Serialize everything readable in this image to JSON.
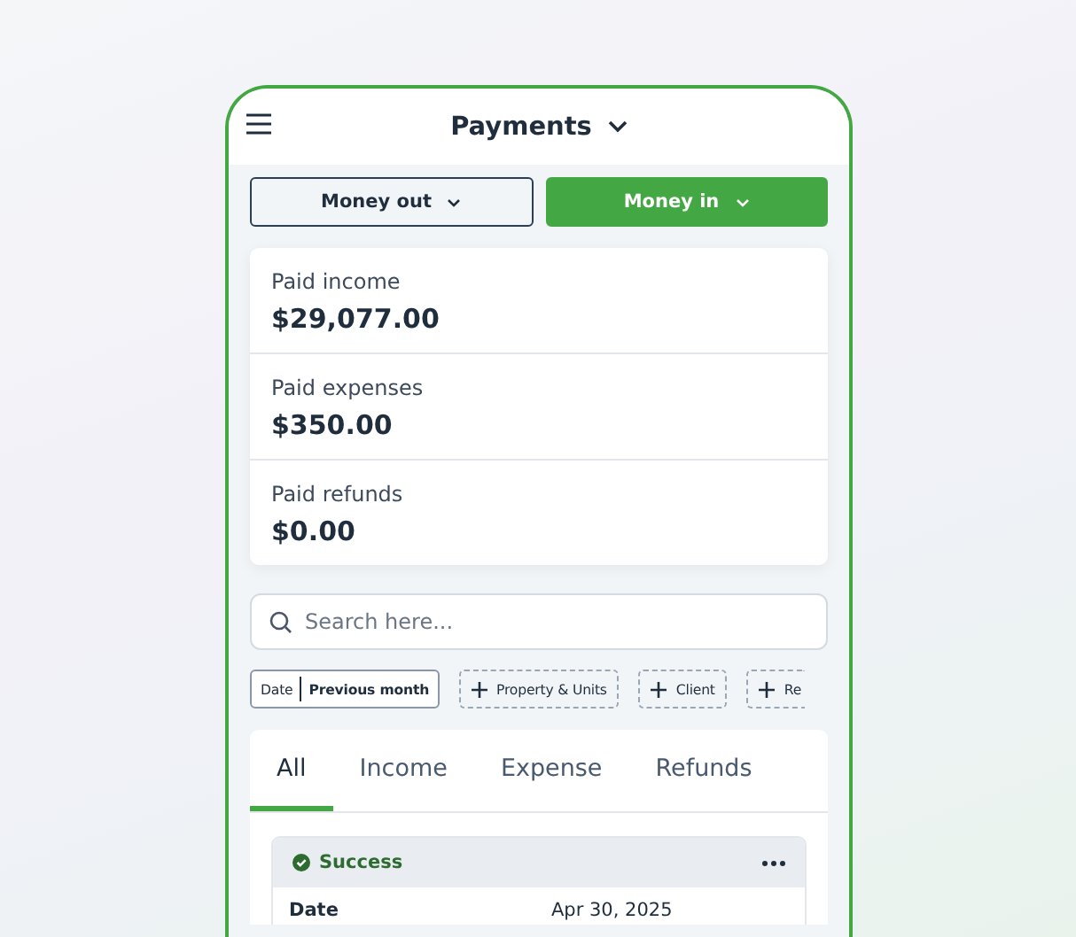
{
  "header": {
    "title": "Payments"
  },
  "direction_buttons": [
    {
      "label": "Money out",
      "selected": false
    },
    {
      "label": "Money in",
      "selected": true
    }
  ],
  "summary": [
    {
      "label": "Paid income",
      "amount": "$29,077.00"
    },
    {
      "label": "Paid expenses",
      "amount": "$350.00"
    },
    {
      "label": "Paid refunds",
      "amount": "$0.00"
    }
  ],
  "search": {
    "placeholder": "Search here..."
  },
  "filters": [
    {
      "kind": "value",
      "label": "Date",
      "value": "Previous month"
    },
    {
      "kind": "add",
      "label": "Property & Units"
    },
    {
      "kind": "add",
      "label": "Client"
    },
    {
      "kind": "add",
      "label": "Re"
    }
  ],
  "tabs": [
    {
      "label": "All",
      "selected": true
    },
    {
      "label": "Income",
      "selected": false
    },
    {
      "label": "Expense",
      "selected": false
    },
    {
      "label": "Refunds",
      "selected": false
    }
  ],
  "transaction": {
    "status": "Success",
    "fields": [
      {
        "label": "Date",
        "value": "Apr 30, 2025"
      }
    ]
  }
}
